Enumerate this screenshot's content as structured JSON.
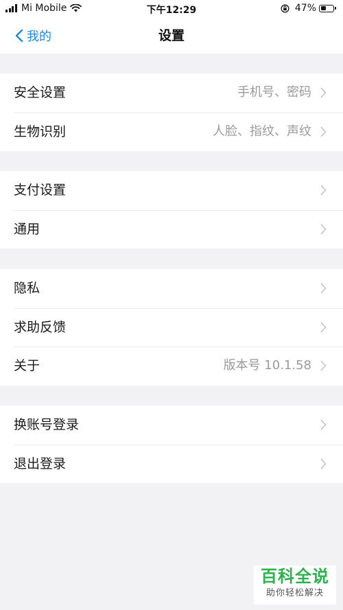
{
  "status_bar": {
    "carrier": "Mi Mobile",
    "time": "下午12:29",
    "battery_percent": "47%",
    "battery_level": 0.47
  },
  "nav": {
    "back_label": "我的",
    "title": "设置"
  },
  "groups": [
    {
      "items": [
        {
          "label": "安全设置",
          "value": "手机号、密码"
        },
        {
          "label": "生物识别",
          "value": "人脸、指纹、声纹"
        }
      ]
    },
    {
      "items": [
        {
          "label": "支付设置",
          "value": ""
        },
        {
          "label": "通用",
          "value": ""
        }
      ]
    },
    {
      "items": [
        {
          "label": "隐私",
          "value": ""
        },
        {
          "label": "求助反馈",
          "value": ""
        },
        {
          "label": "关于",
          "value": "版本号 10.1.58"
        }
      ]
    },
    {
      "items": [
        {
          "label": "换账号登录",
          "value": ""
        },
        {
          "label": "退出登录",
          "value": ""
        }
      ]
    }
  ],
  "watermark": {
    "title": "百科全说",
    "subtitle": "助你轻松解决"
  },
  "colors": {
    "accent": "#1a88ee",
    "background": "#f2f2f4",
    "value_text": "#9a9a9a",
    "watermark_green": "#2bb24c"
  }
}
